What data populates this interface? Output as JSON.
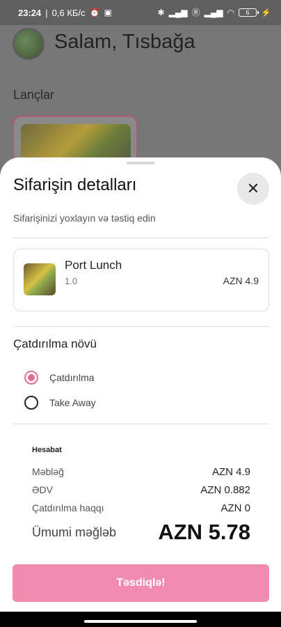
{
  "status_bar": {
    "time": "23:24",
    "speed": "0,6 КБ/с",
    "battery": "6"
  },
  "background": {
    "greeting": "Salam, Tısbağa",
    "section_title": "Lançlar"
  },
  "sheet": {
    "title": "Sifarişin detalları",
    "subtitle": "Sifarişinizi yoxlayın və təstiq edin",
    "item": {
      "name": "Port Lunch",
      "quantity": "1.0",
      "price": "AZN 4.9"
    },
    "delivery": {
      "title": "Çatdırılma növü",
      "options": [
        {
          "label": "Çatdırılma",
          "selected": true
        },
        {
          "label": "Take Away",
          "selected": false
        }
      ]
    },
    "summary": {
      "title": "Hesabat",
      "rows": [
        {
          "label": "Məbləğ",
          "value": "AZN 4.9"
        },
        {
          "label": "ƏDV",
          "value": "AZN 0.882"
        },
        {
          "label": "Çatdırılma haqqı",
          "value": "AZN 0"
        }
      ],
      "total_label": "Ümumi məğləb",
      "total_value": "AZN 5.78"
    },
    "confirm_label": "Təsdiqlə!",
    "close_icon": "close-icon"
  },
  "colors": {
    "accent": "#e56c97",
    "button": "#f28bb0"
  }
}
